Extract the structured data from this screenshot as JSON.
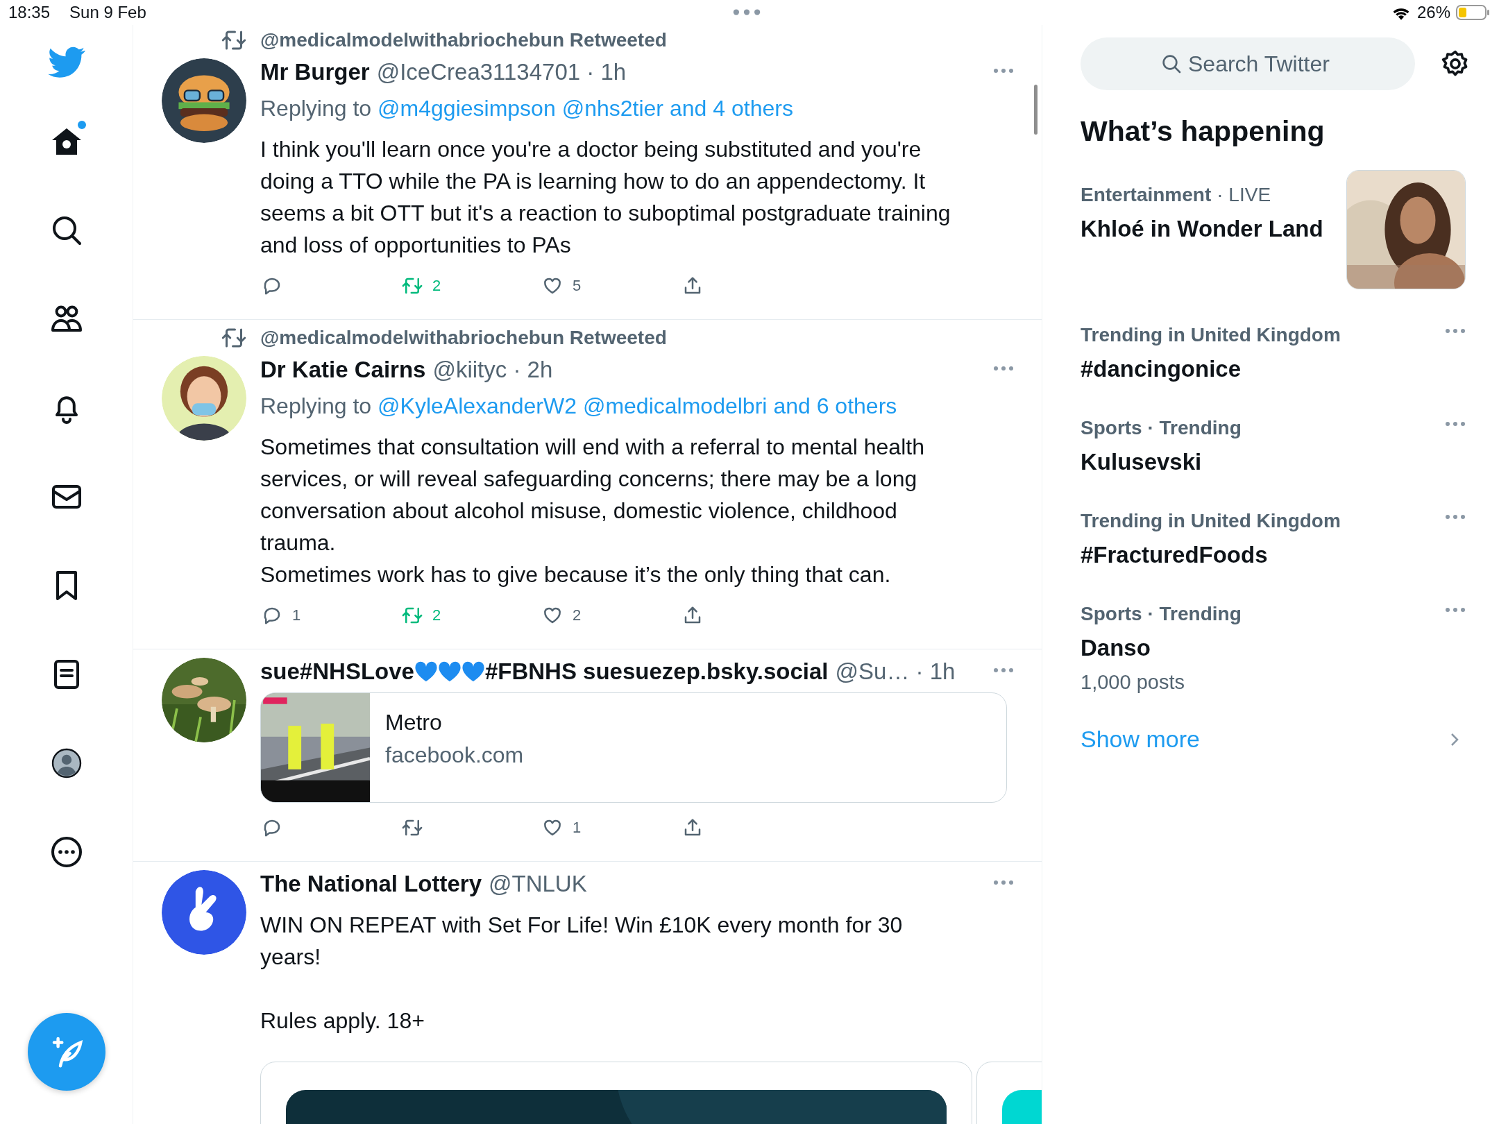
{
  "status_bar": {
    "time": "18:35",
    "date": "Sun 9 Feb",
    "battery": "26%"
  },
  "nav": {
    "items": [
      {
        "kind": "home",
        "selected": true,
        "unread": true
      },
      {
        "kind": "search",
        "selected": false,
        "unread": false
      },
      {
        "kind": "communities",
        "selected": false,
        "unread": false
      },
      {
        "kind": "notifications",
        "selected": false,
        "unread": false
      },
      {
        "kind": "messages",
        "selected": false,
        "unread": false
      },
      {
        "kind": "bookmarks",
        "selected": false,
        "unread": false
      },
      {
        "kind": "lists",
        "selected": false,
        "unread": false
      },
      {
        "kind": "profile",
        "selected": false,
        "unread": false
      },
      {
        "kind": "more",
        "selected": false,
        "unread": false
      }
    ]
  },
  "tweets": [
    {
      "retweeted_by": "@medicalmodelwithabriochebun Retweeted",
      "avatar": {
        "kind": "picture"
      },
      "name": [
        {
          "kind": "text",
          "text": "Mr Burger"
        }
      ],
      "meta": "@IceCrea31134701 · 1h",
      "replying_prefix": "Replying to",
      "replying_to": [
        "@m4ggiesimpson",
        "@nhs2tier",
        "and 4 others"
      ],
      "body": [
        "I think you'll learn once you're a doctor being substituted and you're doing a TTO while the PA is learning how to do an appendectomy. It seems a bit OTT but it's a reaction to suboptimal postgraduate training and loss of opportunities to PAs"
      ],
      "actions": [
        {
          "kind": "reply"
        },
        {
          "kind": "retweet",
          "count": "2",
          "active": true
        },
        {
          "kind": "like",
          "count": "5",
          "active": false
        },
        {
          "kind": "share"
        }
      ]
    },
    {
      "retweeted_by": "@medicalmodelwithabriochebun Retweeted",
      "avatar": {
        "kind": "picture"
      },
      "name": [
        {
          "kind": "text",
          "text": "Dr Katie Cairns"
        }
      ],
      "meta": "@kiityc · 2h",
      "replying_prefix": "Replying to",
      "replying_to": [
        "@KyleAlexanderW2",
        "@medicalmodelbri",
        "and 6 others"
      ],
      "body": [
        "Sometimes that consultation  will end with a referral to mental health services, or will reveal safeguarding concerns; there may be a long conversation about alcohol misuse, domestic violence, childhood trauma.",
        "Sometimes work has to give because it’s the only thing that can."
      ],
      "actions": [
        {
          "kind": "reply",
          "count": "1"
        },
        {
          "kind": "retweet",
          "count": "2",
          "active": true
        },
        {
          "kind": "like",
          "count": "2",
          "active": false
        },
        {
          "kind": "share"
        }
      ]
    },
    {
      "avatar": {
        "kind": "picture"
      },
      "name": [
        {
          "kind": "text",
          "text": "sue#NHSLove"
        },
        {
          "kind": "heart"
        },
        {
          "kind": "heart"
        },
        {
          "kind": "heart"
        },
        {
          "kind": "text",
          "text": "#FBNHS suesuezep.bsky.social"
        }
      ],
      "meta": "@Su… · 1h",
      "card": {
        "title": "Metro",
        "domain": "facebook.com"
      },
      "actions": [
        {
          "kind": "reply"
        },
        {
          "kind": "retweet",
          "active": false
        },
        {
          "kind": "like",
          "count": "1",
          "active": false
        },
        {
          "kind": "share"
        }
      ]
    },
    {
      "avatar": {
        "kind": "picture"
      },
      "name": [
        {
          "kind": "text",
          "text": "The National Lottery"
        }
      ],
      "meta": "@TNLUK",
      "body": [
        "WIN ON REPEAT with Set For Life! Win £10K every month for 30 years!",
        "Rules apply. 18+"
      ],
      "media": [
        {
          "kind": "picture"
        },
        {
          "kind": "picture"
        }
      ]
    }
  ],
  "sidebar": {
    "search": {
      "placeholder": "Search Twitter"
    },
    "heading": "What’s happening",
    "trends": [
      {
        "context": "Entertainment",
        "context_suffix": "· LIVE",
        "title": "Khloé in Wonder Land",
        "image": {
          "kind": "picture"
        }
      },
      {
        "context": "Trending in United Kingdom",
        "title": "#dancingonice"
      },
      {
        "context": "Sports · Trending",
        "title": "Kulusevski"
      },
      {
        "context": "Trending in United Kingdom",
        "title": "#FracturedFoods"
      },
      {
        "context": "Sports · Trending",
        "title": "Danso",
        "posts": "1,000 posts"
      }
    ],
    "show_more": "Show more"
  }
}
